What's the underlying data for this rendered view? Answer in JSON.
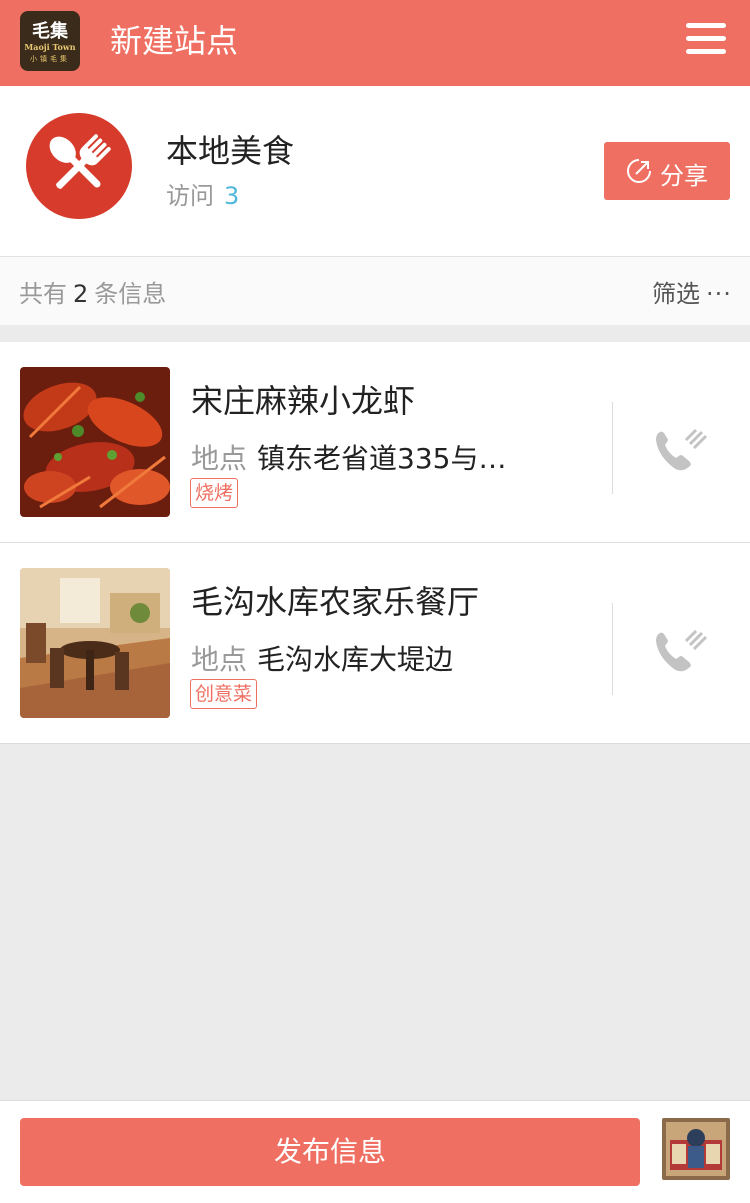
{
  "header": {
    "title": "新建站点",
    "logo": {
      "text1": "毛集",
      "text2": "Maoji Town",
      "text3": "小镇毛集"
    }
  },
  "category": {
    "name": "本地美食",
    "visits_label": "访问",
    "visits": "3",
    "share_label": "分享",
    "icon": "fork-spoon-icon"
  },
  "filter": {
    "prefix": "共有",
    "count": "2",
    "suffix": "条信息",
    "filter_label": "筛选",
    "more": "···"
  },
  "items": [
    {
      "title": "宋庄麻辣小龙虾",
      "loc_label": "地点",
      "location": "镇东老省道335与…",
      "tag": "烧烤"
    },
    {
      "title": "毛沟水库农家乐餐厅",
      "loc_label": "地点",
      "location": "毛沟水库大堤边",
      "tag": "创意菜"
    }
  ],
  "bottom": {
    "publish_label": "发布信息"
  },
  "colors": {
    "accent": "#ef7062",
    "visits": "#4fb8dc",
    "background": "#ebebeb"
  }
}
